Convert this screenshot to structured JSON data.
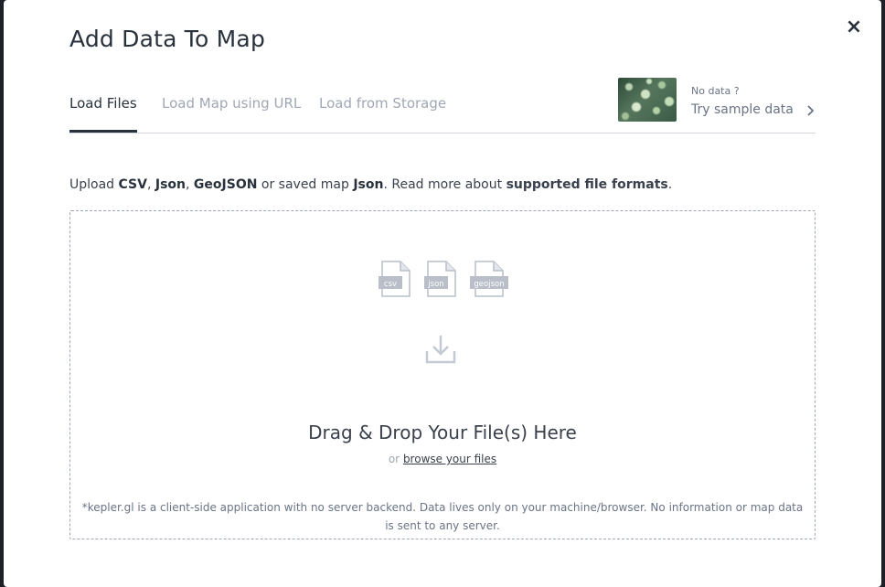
{
  "modal": {
    "title": "Add Data To Map",
    "close_label": "×"
  },
  "tabs": [
    {
      "label": "Load Files",
      "active": true
    },
    {
      "label": "Load Map using URL",
      "active": false
    },
    {
      "label": "Load from Storage",
      "active": false
    }
  ],
  "sample": {
    "no_data": "No data ?",
    "try_label": "Try sample data"
  },
  "upload_message": {
    "prefix": "Upload ",
    "fmt1": "CSV",
    "sep1": ", ",
    "fmt2": "Json",
    "sep2": ", ",
    "fmt3": "GeoJSON",
    "middle": " or saved map ",
    "fmt4": "Json",
    "read_more": ". Read more about ",
    "link": "supported file formats",
    "suffix": "."
  },
  "dropzone": {
    "file_types": [
      "csv",
      "json",
      "geojson"
    ],
    "drag_text": "Drag & Drop Your File(s) Here",
    "or_text": "or ",
    "browse_label": "browse your files",
    "disclaimer": "*kepler.gl is a client-side application with no server backend. Data lives only on your machine/browser. No information or map data is sent to any server."
  },
  "colors": {
    "text_dark": "#29323c",
    "text_muted": "#a0a7b4",
    "icon_gray": "#b9bec8"
  }
}
